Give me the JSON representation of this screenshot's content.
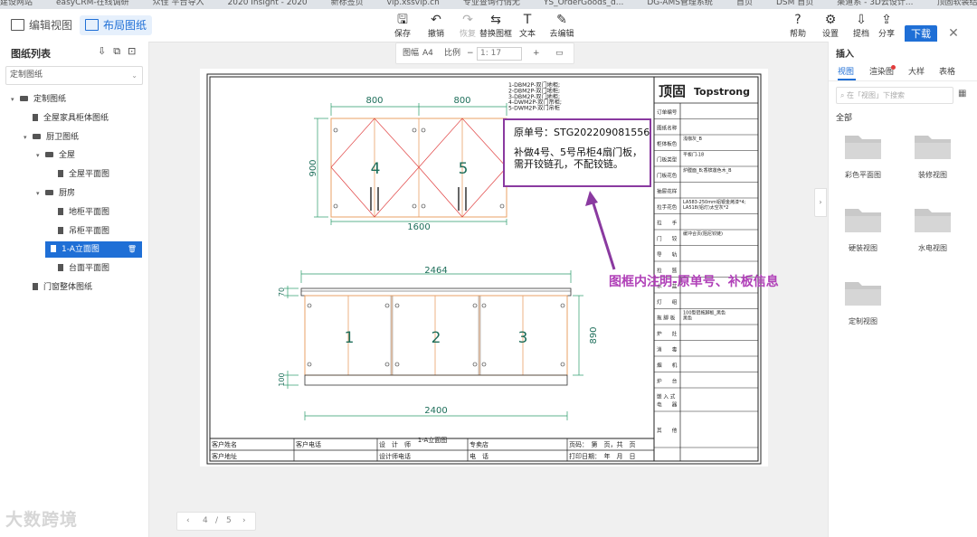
{
  "bookmarks": [
    "建设网站",
    "easyCRM-在线调研",
    "众佳 平台导入",
    "2020 Insight - 2020",
    "新标签页",
    "vip.xssvip.cn",
    "专业查询行情无",
    "YS_OrderGoods_d...",
    "DG-AMS管理系统",
    "首页",
    "DSM 首页",
    "渠道系 - 3D云设计...",
    "顶固软装结构库"
  ],
  "topbar": {
    "mode_edit": "编辑视图",
    "mode_layout": "布局图纸",
    "tools": [
      {
        "icon": "save-icon",
        "glyph": "🖫",
        "label": "保存",
        "enabled": true
      },
      {
        "icon": "undo-icon",
        "glyph": "↶",
        "label": "撤销",
        "enabled": true
      },
      {
        "icon": "redo-icon",
        "glyph": "↷",
        "label": "恢复",
        "enabled": false
      },
      {
        "icon": "replace-frame-icon",
        "glyph": "⇆",
        "label": "替换图框",
        "enabled": true
      },
      {
        "icon": "text-icon",
        "glyph": "T",
        "label": "文本",
        "enabled": true
      },
      {
        "icon": "edit-icon",
        "glyph": "✎",
        "label": "去编辑",
        "enabled": true
      }
    ],
    "right_tools": [
      {
        "icon": "help-icon",
        "glyph": "?",
        "label": "帮助"
      },
      {
        "icon": "settings-icon",
        "glyph": "⚙",
        "label": "设置"
      },
      {
        "icon": "share-icon",
        "glyph": "⇩",
        "label": "提档"
      },
      {
        "icon": "upload-icon",
        "glyph": "⇪",
        "label": "分享"
      }
    ],
    "download_label": "下载",
    "close_glyph": "✕"
  },
  "zoombar": {
    "paper_label": "图幅",
    "paper_value": "A4",
    "scale_label": "比例",
    "minus": "−",
    "scale_value": "1: 17",
    "plus": "+",
    "print_glyph": "▭"
  },
  "left_panel": {
    "title": "图纸列表",
    "select_value": "定制图纸",
    "tree": [
      {
        "label": "定制图纸",
        "level": 0,
        "type": "folder",
        "expanded": true
      },
      {
        "label": "全屋家具柜体图纸",
        "level": 1,
        "type": "file"
      },
      {
        "label": "厨卫图纸",
        "level": 1,
        "type": "folder",
        "expanded": true
      },
      {
        "label": "全屋",
        "level": 2,
        "type": "folder",
        "expanded": true
      },
      {
        "label": "全屋平面图",
        "level": 3,
        "type": "file"
      },
      {
        "label": "厨房",
        "level": 2,
        "type": "folder",
        "expanded": true
      },
      {
        "label": "地柜平面图",
        "level": 3,
        "type": "file"
      },
      {
        "label": "吊柜平面图",
        "level": 3,
        "type": "file"
      },
      {
        "label": "1-A立面图",
        "level": 3,
        "type": "file",
        "selected": true
      },
      {
        "label": "台面平面图",
        "level": 3,
        "type": "file"
      },
      {
        "label": "门窗整体图纸",
        "level": 1,
        "type": "file"
      }
    ]
  },
  "pager": {
    "current": "4",
    "sep": "/",
    "total": "5"
  },
  "watermark": "大数跨境",
  "right_panel": {
    "title": "插入",
    "tabs": [
      "视图",
      "渲染图",
      "大样",
      "表格"
    ],
    "search_placeholder": "在「视图」下搜索",
    "section": "全部",
    "thumbs": [
      "彩色平面图",
      "装修视图",
      "硬装视图",
      "水电视图",
      "定制视图"
    ]
  },
  "drawing": {
    "notes": [
      "1-DBM2P-双门地柜;",
      "2-DBM2P-双门地柜;",
      "3-DBM2P-双门地柜;",
      "4-DWM2P-双门吊柜;",
      "5-DWM2P-双门吊柜"
    ],
    "upper_dims": {
      "w1": "800",
      "w2": "800",
      "height": "900",
      "total": "1600"
    },
    "upper_labels": [
      "4",
      "5"
    ],
    "lower_dims": {
      "top": "2464",
      "h_top": "70",
      "height": "890",
      "h_bottom": "100",
      "total": "2400"
    },
    "lower_labels": [
      "1",
      "2",
      "3"
    ],
    "view_title": "1-A立面图",
    "footer_row1": [
      "客户姓名",
      "客户电话",
      "设　计　师",
      "专卖店",
      "页码：　第　页，共　页"
    ],
    "footer_row2": [
      "客户地址",
      "",
      "设计师电话",
      "电　话",
      "打印日期：　年　月　日"
    ],
    "brand_cn": "顶固",
    "brand_en": "Topstrong",
    "side_labels": [
      "订单编号",
      "图纸名称",
      "柜体板色",
      "门板类型",
      "门板花色",
      "抽屉花样",
      "拉手花色",
      "拉　　手",
      "门　　铰",
      "导　　轨",
      "拉　　篮",
      "水　　盆",
      "灯　　组",
      "拖  脚  板",
      "炉　　灶",
      "消　　毒",
      "烟　　机",
      "炉　　台",
      "嵌 入 式\n电　　器",
      "其　　他",
      "备　　注"
    ],
    "side_values": {
      "柜体板色": "浅咖灰_B",
      "门板类型": "平板门-18",
      "门板花色": "炉膛面_B;香槟莲色木_B",
      "拉手花色": "LA583-250mm铝银金烤漆*4;\nLA518(铝灯)太空灰*2",
      "门　　铰": "缓冲合页(阻尼铰链)",
      "拖  脚  板": "100型铝拖脚板_黑色\n黑色"
    }
  },
  "callout": {
    "order_label": "原单号：STG202209081556",
    "line2": "补做4号、5号吊柜4扇门板，",
    "line3": "需开铰链孔，不配铰链。"
  },
  "annotation": "图框内注明-原单号、补板信息",
  "colors": {
    "accent": "#1f6fd6",
    "annotation": "#b040b8",
    "callout_border": "#8a3aa0",
    "cabinet_line": "#e8a066",
    "diagonal": "#e04040",
    "dimension": "#2a9a6a",
    "reddot": "#e23b3b"
  }
}
